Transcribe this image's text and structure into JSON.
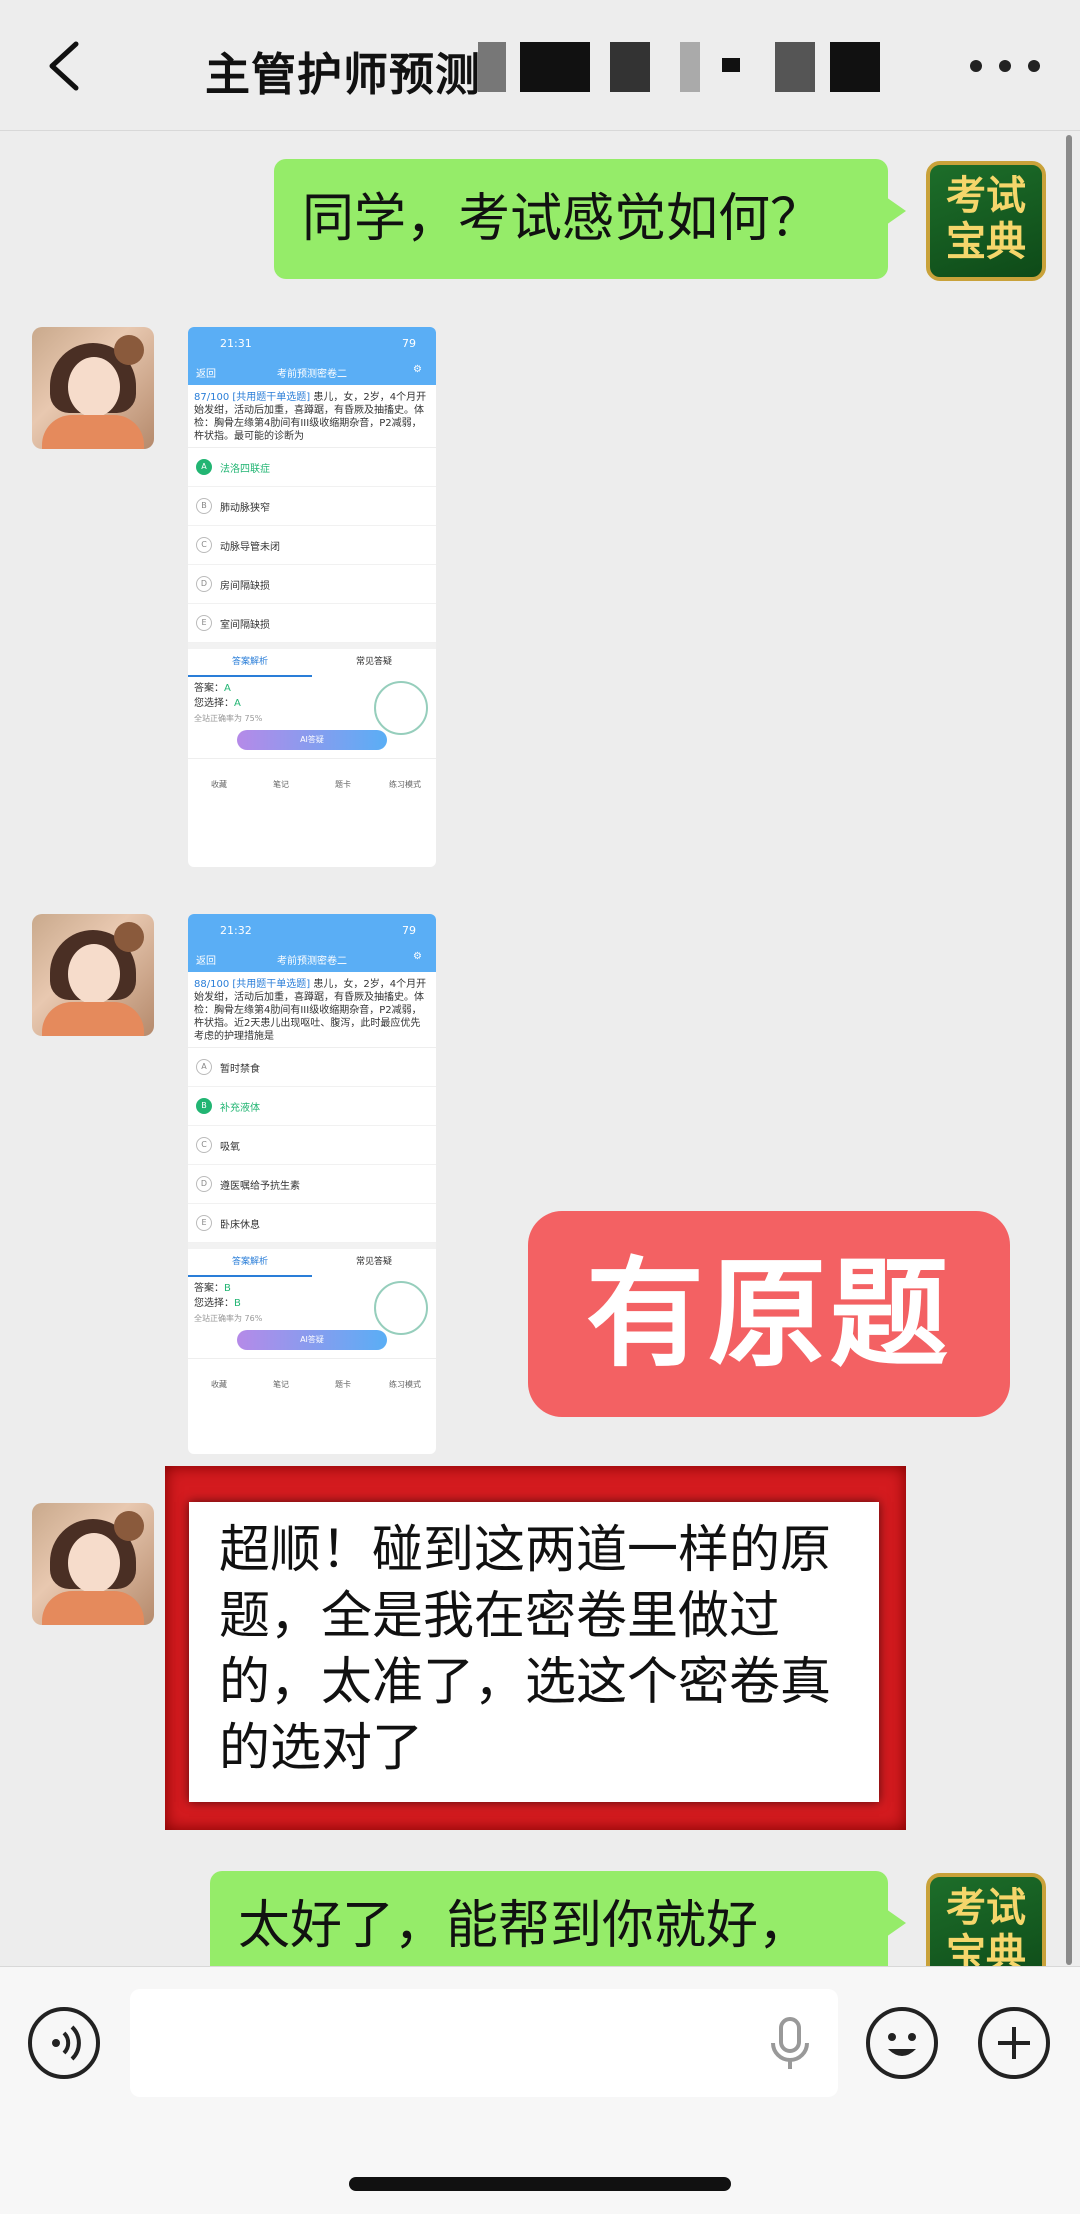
{
  "header": {
    "title": "主管护师预测"
  },
  "messages": {
    "m1_text": "同学，考试感觉如何？",
    "badge_line1": "考试",
    "badge_line2": "宝典",
    "shot1": {
      "time": "21:31",
      "battery": "79",
      "back": "返回",
      "nav_title": "考前预测密卷二",
      "q_num": "87/100",
      "q_type": "[共用题干单选题]",
      "q_text": "患儿，女，2岁，4个月开始发绀，活动后加重，喜蹲踞，有昏厥及抽搐史。体检：胸骨左缘第4肋间有III级收缩期杂音，P2减弱，杵状指。最可能的诊断为",
      "options": [
        "法洛四联症",
        "肺动脉狭窄",
        "动脉导管未闭",
        "房间隔缺损",
        "室间隔缺损"
      ],
      "selected_letter": "A",
      "tab_left": "答案解析",
      "tab_right": "常见答疑",
      "answer_label": "答案：",
      "answer": "A",
      "choice_label": "您选择：",
      "choice": "A",
      "rate": "全站正确率为 75%",
      "ai": "AI答疑",
      "bar": [
        "收藏",
        "笔记",
        "题卡",
        "练习模式"
      ]
    },
    "shot2": {
      "time": "21:32",
      "battery": "79",
      "back": "返回",
      "nav_title": "考前预测密卷二",
      "q_num": "88/100",
      "q_type": "[共用题干单选题]",
      "q_text": "患儿，女，2岁，4个月开始发绀，活动后加重，喜蹲踞，有昏厥及抽搐史。体检：胸骨左缘第4肋间有III级收缩期杂音，P2减弱，杵状指。近2天患儿出现呕吐、腹泻，此时最应优先考虑的护理措施是",
      "options": [
        "暂时禁食",
        "补充液体",
        "吸氧",
        "遵医嘱给予抗生素",
        "卧床休息"
      ],
      "selected_letter": "B",
      "tab_left": "答案解析",
      "tab_right": "常见答疑",
      "answer_label": "答案：",
      "answer": "B",
      "choice_label": "您选择：",
      "choice": "B",
      "rate": "全站正确率为 76%",
      "ai": "AI答疑",
      "bar": [
        "收藏",
        "笔记",
        "题卡",
        "练习模式"
      ]
    },
    "red_bubble": "有原题",
    "m_review": "超顺！碰到这两道一样的原题，全是我在密卷里做过的，太准了，选这个密卷真的选对了",
    "m_last": "太好了，能帮到你就好，"
  },
  "colors": {
    "wechat_green": "#95ec69",
    "highlight_red": "#f36163",
    "frame_red": "#d41b1f",
    "app_blue": "#5aaef5",
    "correct_green": "#22b573"
  },
  "icons": [
    "back-arrow-icon",
    "more-icon",
    "voice-icon",
    "mic-icon",
    "emoji-icon",
    "plus-icon"
  ]
}
